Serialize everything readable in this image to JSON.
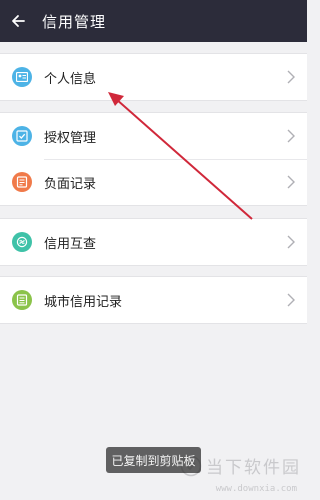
{
  "header": {
    "title": "信用管理",
    "back_icon": "back-arrow-icon"
  },
  "groups": [
    {
      "items": [
        {
          "label": "个人信息",
          "icon": "id-card-icon",
          "color": "#4db3e6"
        }
      ]
    },
    {
      "items": [
        {
          "label": "授权管理",
          "icon": "authorize-icon",
          "color": "#4db3e6"
        },
        {
          "label": "负面记录",
          "icon": "negative-record-icon",
          "color": "#f07a4a"
        }
      ]
    },
    {
      "items": [
        {
          "label": "信用互查",
          "icon": "mutual-check-icon",
          "color": "#3fc2a8"
        }
      ]
    },
    {
      "items": [
        {
          "label": "城市信用记录",
          "icon": "city-record-icon",
          "color": "#8bc34a"
        }
      ]
    }
  ],
  "toast": {
    "text": "已复制到剪贴板"
  },
  "watermark": {
    "title": "当下软件园",
    "url": "www.downxia.com"
  },
  "colors": {
    "header_bg": "#2c2c3a",
    "page_bg": "#f1f1f3",
    "annotation_arrow": "#d0283a"
  }
}
